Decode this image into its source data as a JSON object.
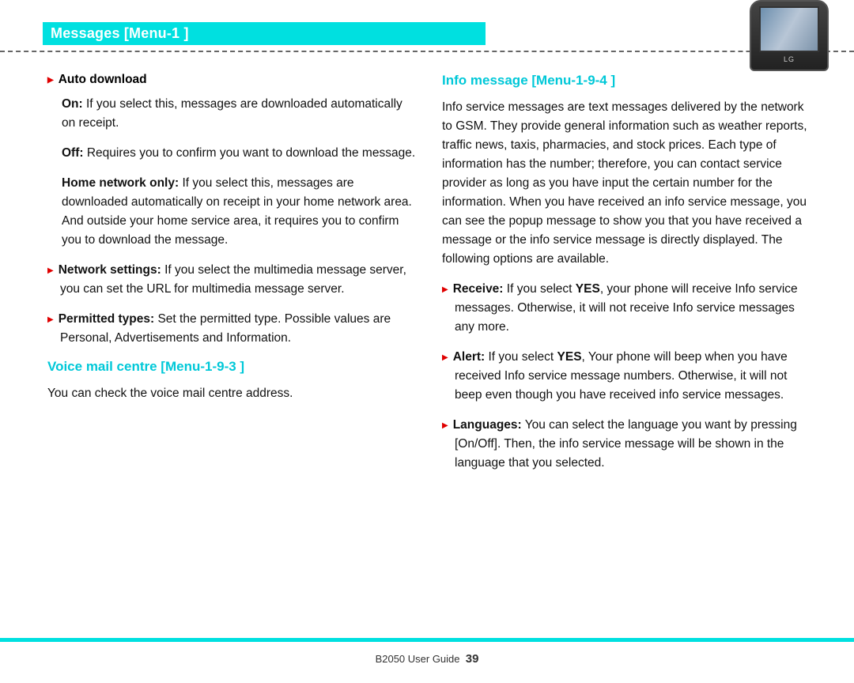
{
  "header": {
    "title": "Messages [Menu-1 ]"
  },
  "left": {
    "auto_dl_label": "Auto download",
    "on_label": "On:",
    "on_text": " If you select this, messages are downloaded automatically on receipt.",
    "off_label": "Off:",
    "off_text": " Requires you to confirm you want to download the message.",
    "home_label": "Home network only:",
    "home_text": " If you select this, messages are downloaded automatically on receipt in your home network area. And outside your home service area, it requires you to confirm you to download the message.",
    "net_label": "Network settings:",
    "net_text": " If you select the multimedia message server, you can set the URL for multimedia message server.",
    "perm_label": "Permitted types:",
    "perm_text": " Set the permitted type. Possible values are Personal, Advertisements and Information.",
    "voice_head": "Voice mail centre [Menu-1-9-3 ]",
    "voice_text": "You can check the voice mail centre address."
  },
  "right": {
    "info_head": "Info message [Menu-1-9-4 ]",
    "info_para": "Info service messages are text messages delivered by the network to GSM. They provide general information such as weather reports, traffic news, taxis, pharmacies, and stock prices. Each type of information has the number; therefore, you can contact service provider as long as you have input the certain number for the information. When you have received an info service message, you can see the popup message to show you that you have received a message or the info service message is directly displayed. The following options are available.",
    "recv_label": "Receive:",
    "recv_yes": "YES",
    "recv_text_a": " If you select ",
    "recv_text_b": ", your phone will receive Info service messages. Otherwise, it will not receive Info service messages any more.",
    "alert_label": "Alert:",
    "alert_yes": "YES",
    "alert_text_a": " If you select ",
    "alert_text_b": ", Your phone will beep when you have received Info service message numbers. Otherwise, it will not beep even though you have received info service messages.",
    "lang_label": "Languages:",
    "lang_text": " You can select the language you want by pressing [On/Off]. Then, the info service message will be shown in the language that you selected."
  },
  "footer": {
    "guide": "B2050 User Guide",
    "page": "39"
  },
  "phone": {
    "brand": "LG"
  }
}
